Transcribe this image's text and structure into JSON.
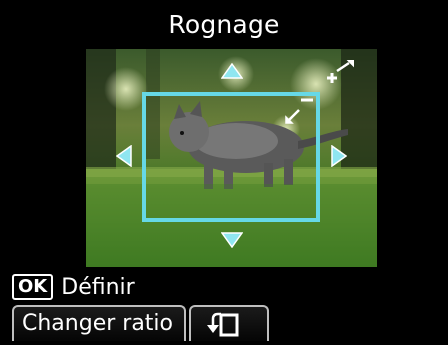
{
  "screen": {
    "title": "Rognage",
    "ok_key": "OK",
    "ok_label": "Définir",
    "change_ratio_label": "Changer ratio"
  },
  "icons": {
    "arrow_up": "arrow-up-icon",
    "arrow_down": "arrow-down-icon",
    "arrow_left": "arrow-left-icon",
    "arrow_right": "arrow-right-icon",
    "zoom_in": "zoom-in-icon",
    "zoom_out": "zoom-out-icon",
    "rotate": "rotate-crop-icon"
  },
  "colors": {
    "crop_frame": "#66d8e6",
    "background": "#000000",
    "text": "#ffffff"
  }
}
